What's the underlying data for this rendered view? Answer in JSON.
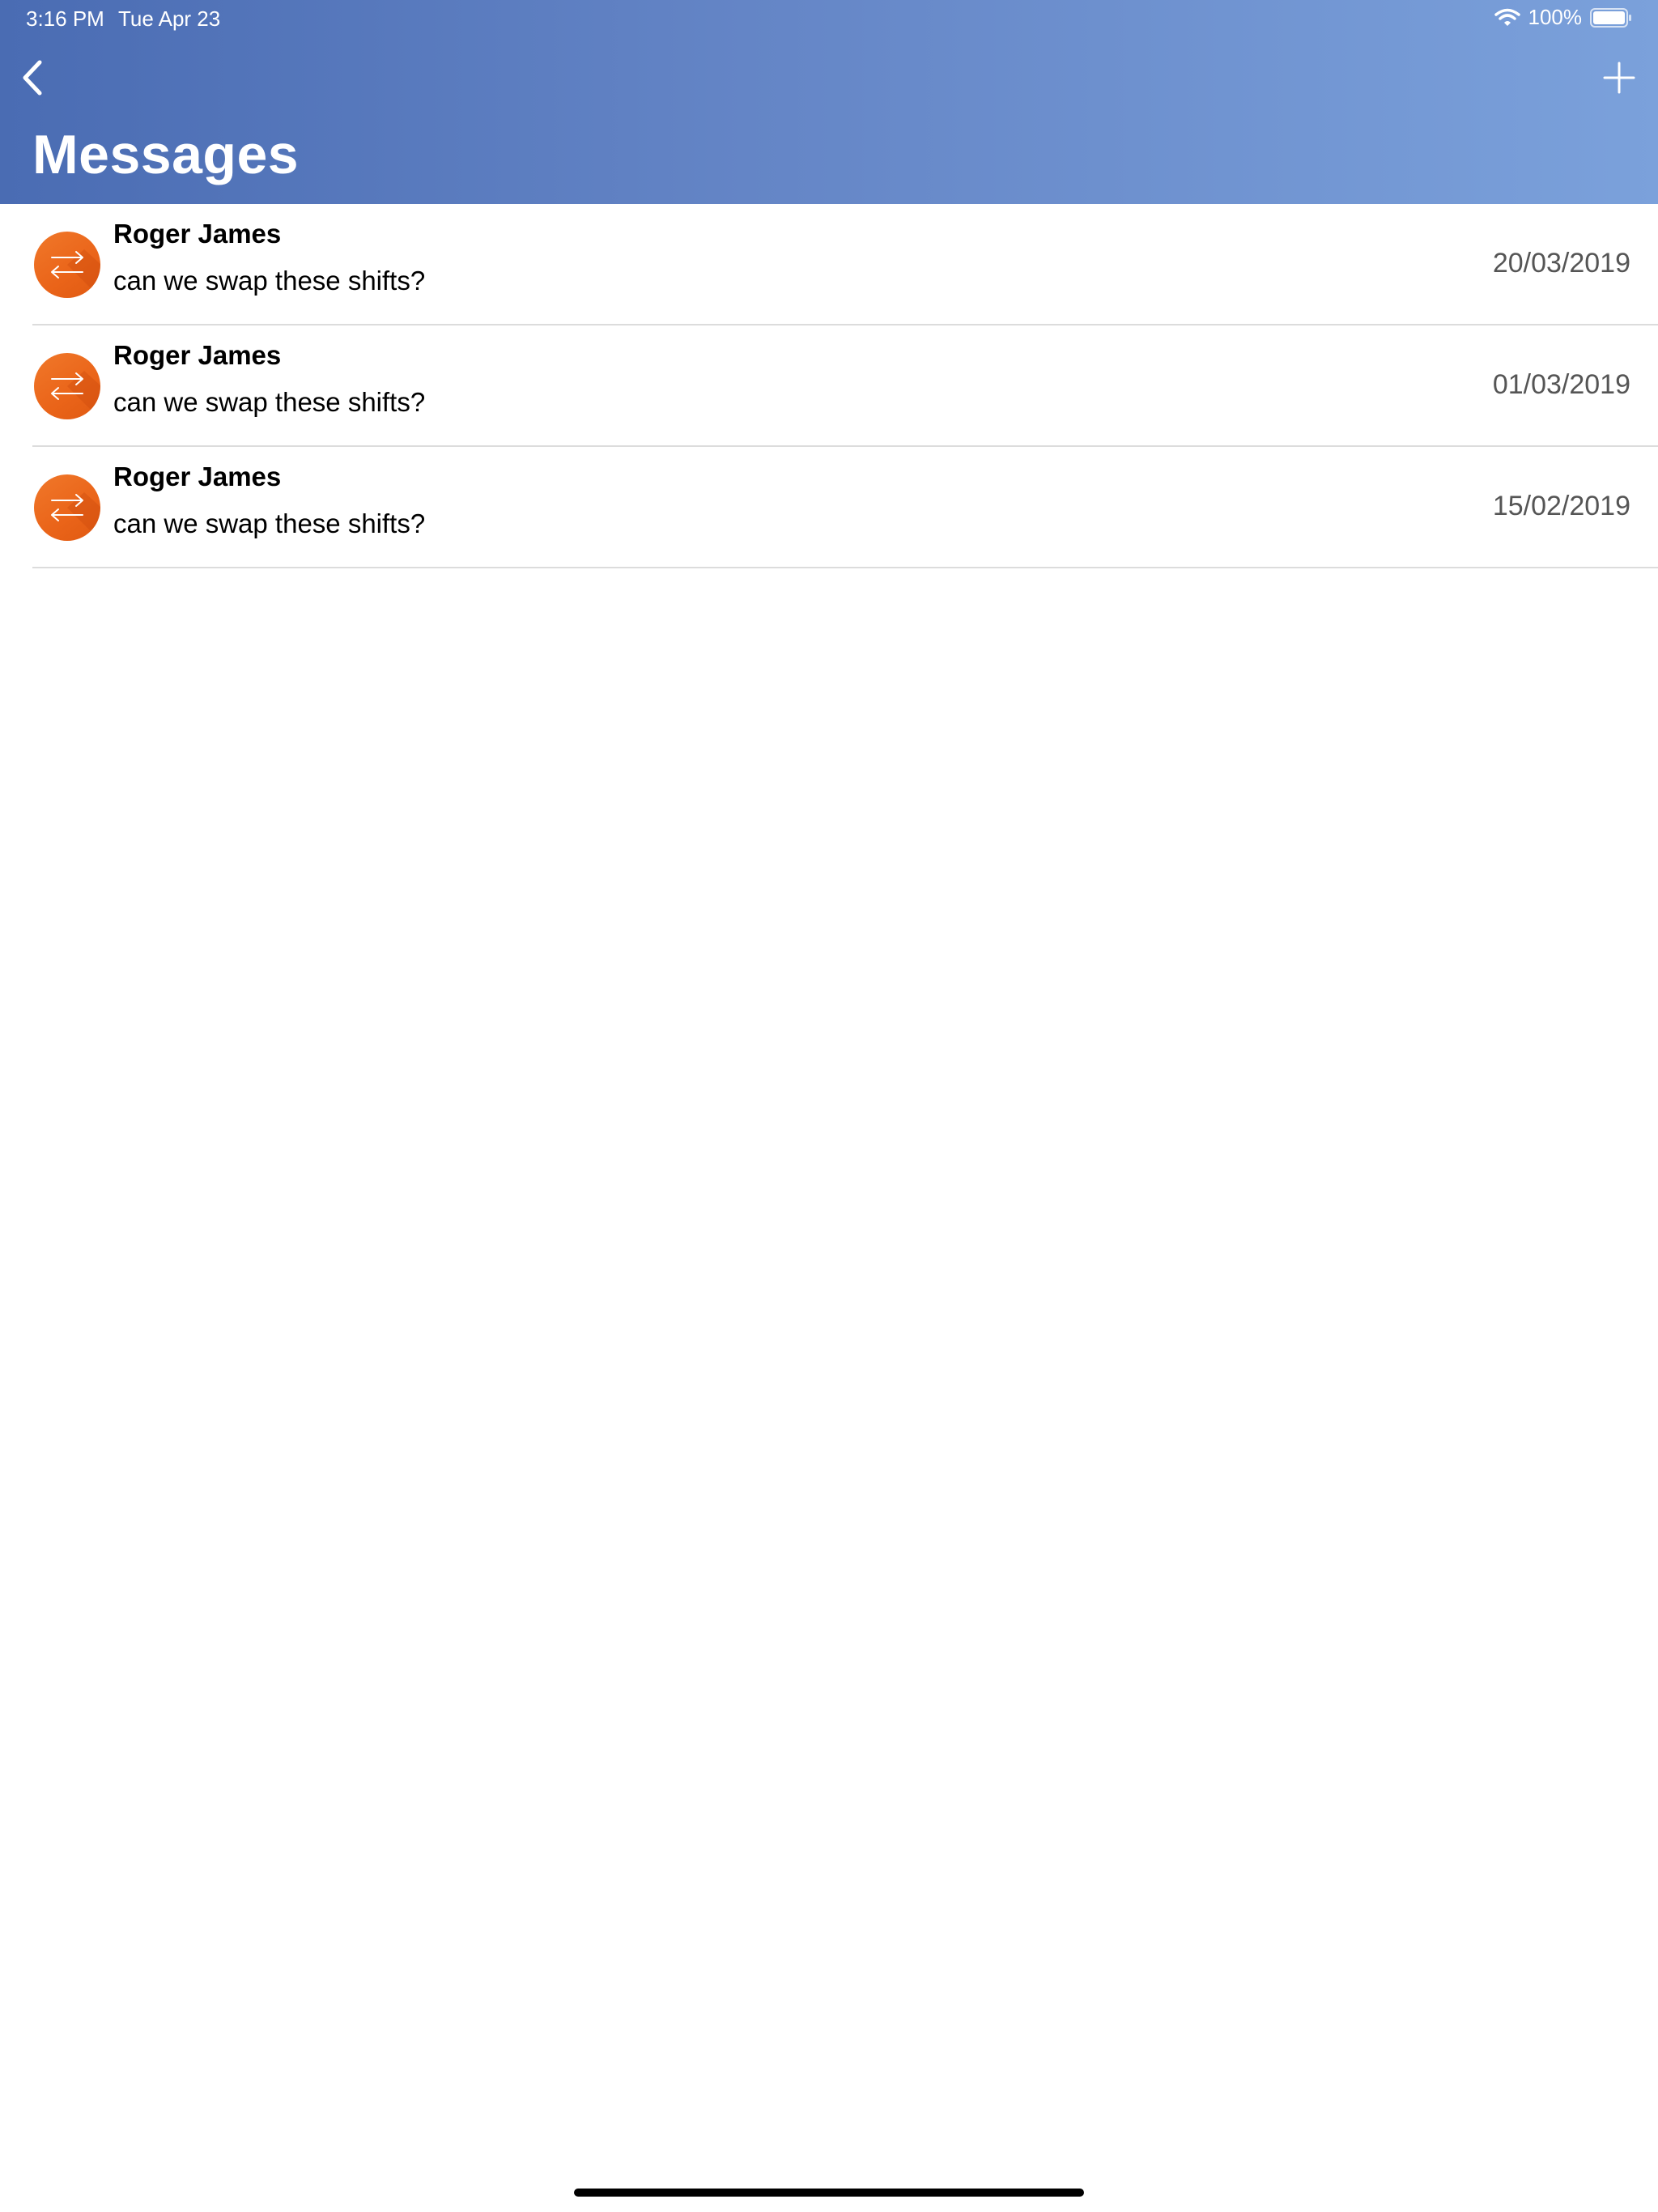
{
  "status_bar": {
    "time": "3:16 PM",
    "date": "Tue Apr 23",
    "battery": "100%",
    "wifi_icon": "wifi-icon",
    "battery_icon": "battery-full-icon"
  },
  "nav": {
    "back_icon": "chevron-left-icon",
    "add_icon": "plus-icon",
    "title": "Messages"
  },
  "colors": {
    "header_gradient_start": "#4a6cb3",
    "header_gradient_end": "#7ba1db",
    "avatar": "#ea6419",
    "divider": "#dcdcdc",
    "date_text": "#555555"
  },
  "messages": [
    {
      "sender": "Roger James",
      "preview": "can we swap these shifts?",
      "date": "20/03/2019",
      "icon": "swap-arrows-icon"
    },
    {
      "sender": "Roger James",
      "preview": "can we swap these shifts?",
      "date": "01/03/2019",
      "icon": "swap-arrows-icon"
    },
    {
      "sender": "Roger James",
      "preview": "can we swap these shifts?",
      "date": "15/02/2019",
      "icon": "swap-arrows-icon"
    }
  ]
}
